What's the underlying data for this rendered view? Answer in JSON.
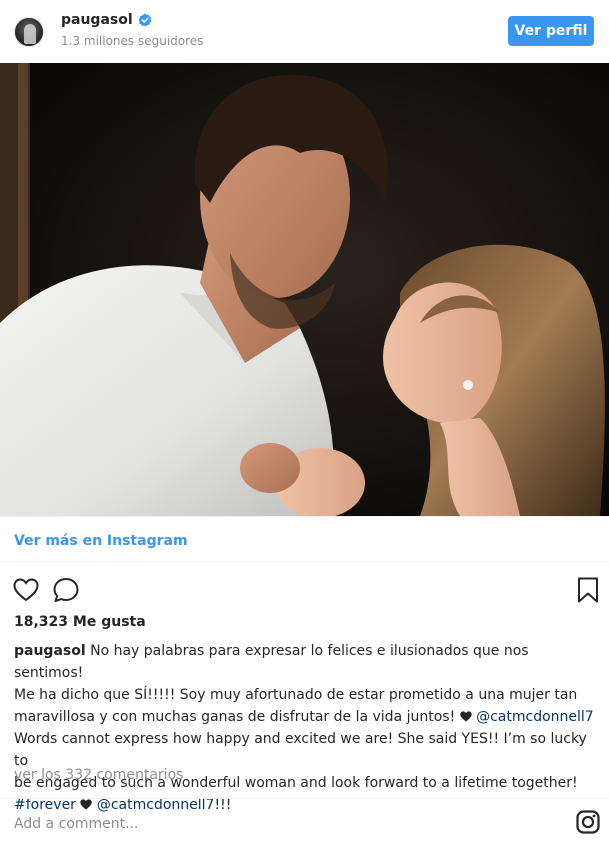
{
  "header": {
    "username": "paugasol",
    "followers": "1.3 millones seguidores",
    "view_profile": "Ver perfil",
    "brand_blue": "#3897f0"
  },
  "post": {
    "more_link": "Ver más en Instagram",
    "likes": "18,323 Me gusta",
    "caption": {
      "user": "paugasol",
      "line1": "No hay palabras para expresar lo felices e ilusionados que nos sentimos!",
      "line2": "Me ha dicho que SÍ!!!!! Soy muy afortunado de estar prometido a una mujer tan",
      "line3a": "maravillosa y con muchas ganas de disfrutar de la vida juntos!",
      "mention": "@catmcdonnell7",
      "line4": "Words cannot express how happy and excited we are! She said YES!! I’m so lucky to",
      "line5": "be engaged to such a wonderful woman and look forward to a lifetime together!",
      "hashtag": "#forever",
      "mention2": "@catmcdonnell7",
      "tail": "!!!"
    },
    "comments_link": "ver los 332 comentarios",
    "add_comment": "Add a comment..."
  },
  "icons": {
    "like": "heart-outline-icon",
    "comment": "comment-icon",
    "save": "bookmark-icon",
    "instagram": "instagram-icon",
    "verified": "verified-badge-icon"
  }
}
